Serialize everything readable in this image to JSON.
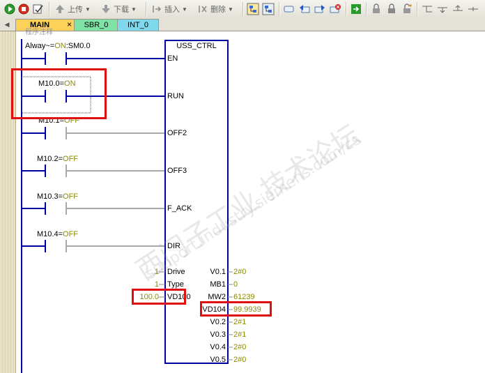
{
  "toolbar": {
    "upload_label": "上传",
    "download_label": "下载",
    "insert_label": "插入",
    "delete_label": "删除"
  },
  "tabs": [
    {
      "label": "MAIN",
      "active": true,
      "close": "×"
    },
    {
      "label": "SBR_0",
      "active": false
    },
    {
      "label": "INT_0",
      "active": false
    }
  ],
  "network": {
    "comment": "程序注释",
    "contact_main": {
      "name": "Alway~",
      "sep": "=",
      "state": "ON",
      "address": ":SM0.0"
    },
    "contacts": [
      {
        "name": "M10.0",
        "state": "ON"
      },
      {
        "name": "M10.1",
        "state": "OFF"
      },
      {
        "name": "M10.2",
        "state": "OFF"
      },
      {
        "name": "M10.3",
        "state": "OFF"
      },
      {
        "name": "M10.4",
        "state": "OFF"
      }
    ],
    "block": {
      "title": "USS_CTRL",
      "bool_inputs": [
        "EN",
        "RUN",
        "OFF2",
        "OFF3",
        "F_ACK",
        "DIR"
      ],
      "value_inputs": [
        {
          "value": "1",
          "pin": "Drive"
        },
        {
          "value": "1",
          "pin": "Type"
        },
        {
          "value": "100.0",
          "pin": "VD100"
        }
      ],
      "outputs": [
        {
          "pin": "V0.1",
          "value": "2#0"
        },
        {
          "pin": "MB1",
          "value": "0"
        },
        {
          "pin": "MW2",
          "value": "61239"
        },
        {
          "pin": "VD104",
          "value": "99.9939"
        },
        {
          "pin": "V0.2",
          "value": "2#1"
        },
        {
          "pin": "V0.3",
          "value": "2#1"
        },
        {
          "pin": "V0.4",
          "value": "2#0"
        },
        {
          "pin": "V0.5",
          "value": "2#0"
        }
      ]
    }
  },
  "watermark": {
    "line1": "西门子工业 技术论坛",
    "line2": "support.industry.siemens.com/cs"
  },
  "colors": {
    "block_border": "#0000a0",
    "rung_active": "#0000a0",
    "rung_inactive": "#a8a8a8",
    "status_value": "#8a8a00",
    "highlight": "#e01010"
  }
}
